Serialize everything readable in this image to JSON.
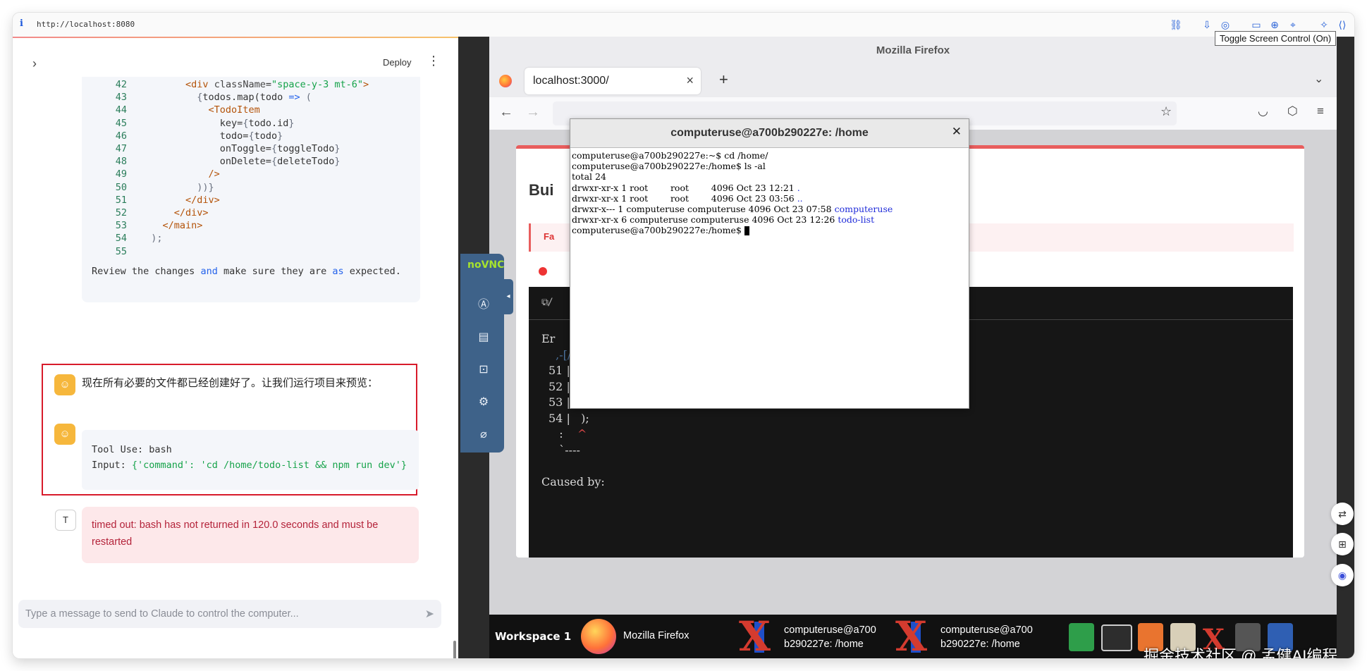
{
  "browser": {
    "info_icon": "i",
    "url": "http://localhost:8080",
    "toolbar_icons": [
      "link-icon",
      "download-icon",
      "camera-icon",
      "tab-icon",
      "globe-icon",
      "crosshair-icon",
      "sparkle-icon"
    ]
  },
  "chat": {
    "deploy_label": "Deploy",
    "code_lines": [
      {
        "n": "42",
        "html": "        <span class='c-tag'>&lt;div</span> <span class='c-attr'>className</span>=<span class='c-str'>\"space-y-3 mt-6\"</span><span class='c-tag'>&gt;</span>"
      },
      {
        "n": "43",
        "html": "          <span class='c-br'>{</span>todos.map(todo <span class='c-kw'>=&gt;</span> <span class='c-br'>(</span>"
      },
      {
        "n": "44",
        "html": "            <span class='c-tag'>&lt;TodoItem</span>"
      },
      {
        "n": "45",
        "html": "              key=<span class='c-br'>{</span>todo.id<span class='c-br'>}</span>"
      },
      {
        "n": "46",
        "html": "              todo=<span class='c-br'>{</span>todo<span class='c-br'>}</span>"
      },
      {
        "n": "47",
        "html": "              onToggle=<span class='c-br'>{</span>toggleTodo<span class='c-br'>}</span>"
      },
      {
        "n": "48",
        "html": "              onDelete=<span class='c-br'>{</span>deleteTodo<span class='c-br'>}</span>"
      },
      {
        "n": "49",
        "html": "            <span class='c-tag'>/&gt;</span>"
      },
      {
        "n": "50",
        "html": "          <span class='c-br'>))}</span>"
      },
      {
        "n": "51",
        "html": "        <span class='c-tag'>&lt;/div&gt;</span>"
      },
      {
        "n": "52",
        "html": "      <span class='c-tag'>&lt;/div&gt;</span>"
      },
      {
        "n": "53",
        "html": "    <span class='c-tag'>&lt;/main&gt;</span>"
      },
      {
        "n": "54",
        "html": "  <span class='c-br'>);</span>"
      },
      {
        "n": "55",
        "html": ""
      }
    ],
    "review_text": "Review the changes <span class='kw'>and</span> make sure they are <span class='kw'>as</span> expected.",
    "assistant_message": "现在所有必要的文件都已经创建好了。让我们运行项目来预览：",
    "tool_use_line": "Tool Use: bash",
    "tool_input_prefix": "Input: ",
    "tool_input_value": "{'command': 'cd /home/todo-list && npm run dev'}",
    "user_avatar": "T",
    "error_message": "timed out: bash has not returned in 120.0 seconds and must be restarted",
    "input_placeholder": "Type a message to send to Claude to control the computer..."
  },
  "vnc": {
    "logo": "noVNC",
    "toggle_label": "Toggle Screen Control (On)"
  },
  "firefox": {
    "window_title": "Mozilla Firefox",
    "tab_title": "localhost:3000/",
    "page_title": "Bui",
    "error_strip_text": "Fa",
    "panel_header": "./",
    "terminal_lines": [
      {
        "cls": "",
        "text": "Er"
      },
      {
        "cls": "path",
        "text": "  ,-[/home/todo-list/app/page.tsx:51:1]"
      },
      {
        "cls": "",
        "text": "51 |         </div>"
      },
      {
        "cls": "",
        "text": "52 |       </div>"
      },
      {
        "cls": "",
        "text": "53 |     </main>"
      },
      {
        "cls": "",
        "text": "54 |   );"
      },
      {
        "cls": "",
        "text": "   :    ^"
      },
      {
        "cls": "",
        "text": "   `----"
      },
      {
        "cls": "",
        "text": ""
      },
      {
        "cls": "",
        "text": "Caused by:"
      }
    ]
  },
  "xterm": {
    "title": "computeruse@a700b290227e: /home",
    "lines": [
      "computeruse@a700b290227e:~$ cd /home/",
      "computeruse@a700b290227e:/home$ ls -al",
      "total 24",
      "drwxr-xr-x 1 root        root        4096 Oct 23 12:21 ",
      "drwxr-xr-x 1 root        root        4096 Oct 23 03:56 ",
      "drwxr-x--- 1 computeruse computeruse 4096 Oct 23 07:58 ",
      "drwxr-xr-x 6 computeruse computeruse 4096 Oct 23 12:26 ",
      "computeruse@a700b290227e:/home$ "
    ],
    "dir_names": [
      ".",
      "..",
      "computeruse",
      "todo-list"
    ]
  },
  "taskbar": {
    "workspace": "Workspace 1",
    "firefox_label": "Mozilla Firefox",
    "term1_label_a": "computeruse@a700",
    "term1_label_b": "b290227e: /home",
    "term2_label_a": "computeruse@a700",
    "term2_label_b": "b290227e: /home",
    "watermark": "掘金技术社区 @ 孟健AI编程"
  }
}
